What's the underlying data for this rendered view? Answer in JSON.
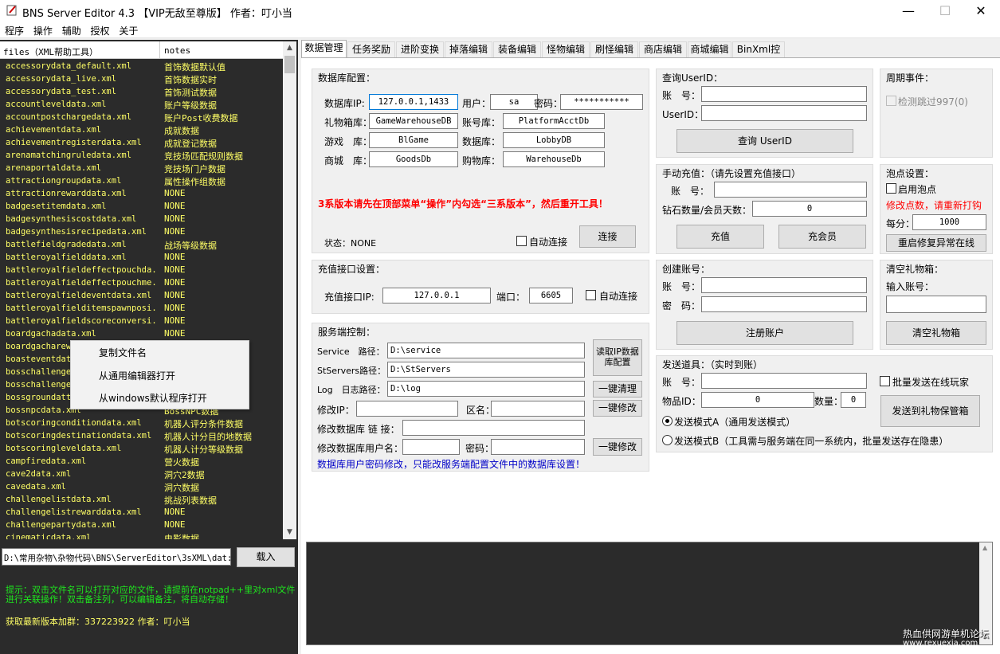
{
  "window": {
    "title": "BNS Server Editor 4.3 【VIP无敌至尊版】 作者：叮小当",
    "minimize": "—",
    "maximize": "☐",
    "close": "✕"
  },
  "menu": [
    "程序",
    "操作",
    "辅助",
    "授权",
    "关于"
  ],
  "file_list": {
    "col_files": "files（XML帮助工具）",
    "col_notes": "notes",
    "rows": [
      {
        "file": "accessorydata_default.xml",
        "note": "首饰数据默认值"
      },
      {
        "file": "accessorydata_live.xml",
        "note": "首饰数据实时"
      },
      {
        "file": "accessorydata_test.xml",
        "note": "首饰测试数据"
      },
      {
        "file": "accountleveldata.xml",
        "note": "账户等级数据"
      },
      {
        "file": "accountpostchargedata.xml",
        "note": "账户Post收费数据"
      },
      {
        "file": "achievementdata.xml",
        "note": "成就数据"
      },
      {
        "file": "achievementregisterdata.xml",
        "note": "成就登记数据"
      },
      {
        "file": "arenamatchingruledata.xml",
        "note": "竞技场匹配规则数据"
      },
      {
        "file": "arenaportaldata.xml",
        "note": "竞技场门户数据"
      },
      {
        "file": "attractiongroupdata.xml",
        "note": "属性操作组数据"
      },
      {
        "file": "attractionrewarddata.xml",
        "note": "NONE"
      },
      {
        "file": "badgesetitemdata.xml",
        "note": "NONE"
      },
      {
        "file": "badgesynthesiscostdata.xml",
        "note": "NONE"
      },
      {
        "file": "badgesynthesisrecipedata.xml",
        "note": "NONE"
      },
      {
        "file": "battlefieldgradedata.xml",
        "note": "战场等级数据"
      },
      {
        "file": "battleroyalfielddata.xml",
        "note": "NONE"
      },
      {
        "file": "battleroyalfieldeffectpouchda...",
        "note": "NONE"
      },
      {
        "file": "battleroyalfieldeffectpouchme...",
        "note": "NONE"
      },
      {
        "file": "battleroyalfieldeventdata.xml",
        "note": "NONE"
      },
      {
        "file": "battleroyalfielditemspawnposi...",
        "note": "NONE"
      },
      {
        "file": "battleroyalfieldscoreconversi...",
        "note": "NONE"
      },
      {
        "file": "boardgachadata.xml",
        "note": "NONE"
      },
      {
        "file": "boardgacharewa",
        "note": ""
      },
      {
        "file": "boasteventdate",
        "note": ""
      },
      {
        "file": "bosschallenged",
        "note": ""
      },
      {
        "file": "bosschallenger",
        "note": ""
      },
      {
        "file": "bossgroundatte",
        "note": "模..."
      },
      {
        "file": "bossnpcdata.xml",
        "note": "BossNPC数据"
      },
      {
        "file": "botscoringconditiondata.xml",
        "note": "机器人评分条件数据"
      },
      {
        "file": "botscoringdestinationdata.xml",
        "note": "机器人计分目的地数据"
      },
      {
        "file": "botscoringleveldata.xml",
        "note": "机器人计分等级数据"
      },
      {
        "file": "campfiredata.xml",
        "note": "营火数据"
      },
      {
        "file": "cave2data.xml",
        "note": "洞穴2数据"
      },
      {
        "file": "cavedata.xml",
        "note": "洞穴数据"
      },
      {
        "file": "challengelistdata.xml",
        "note": "挑战列表数据"
      },
      {
        "file": "challengelistrewarddata.xml",
        "note": "NONE"
      },
      {
        "file": "challengepartydata.xml",
        "note": "NONE"
      },
      {
        "file": "cinematicdata.xml",
        "note": "电影数据"
      }
    ]
  },
  "context_menu": [
    "复制文件名",
    "从通用编辑器打开",
    "从windows默认程序打开"
  ],
  "path_value": "D:\\常用杂物\\杂物代码\\BNS\\ServerEditor\\3sXML\\dat:",
  "load_button": "载入",
  "tip_text": "提示：双击文件名可以打开对应的文件，请提前在notpad++里对xml文件进行关联操作！双击备注列，可以编辑备注，将自动存储！",
  "group_text": "获取最新版本加群：337223922 作者：叮小当",
  "tabs": [
    "数据管理",
    "任务奖励",
    "进阶变换",
    "掉落编辑",
    "装备编辑",
    "怪物编辑",
    "刷怪编辑",
    "商店编辑",
    "商城编辑",
    "BinXml控制"
  ],
  "db_config": {
    "title": "数据库配置：",
    "ip_label": "数据库IP:",
    "ip": "127.0.0.1,1433",
    "user_label": "用户：",
    "user": "sa",
    "pwd_label": "密码：",
    "pwd": "***********",
    "gift_label": "礼物箱库：",
    "gift": "GameWarehouseDB",
    "acct_label": "账号库：",
    "acct": "PlatformAcctDb",
    "game_label": "游戏　库：",
    "game": "BlGame",
    "data_label": "数据库：",
    "data": "LobbyDB",
    "mall_label": "商城　库：",
    "mall": "GoodsDb",
    "cart_label": "购物库：",
    "cart": "WarehouseDb",
    "warning": "3系版本请先在顶部菜单“操作”内勾选“三系版本”，然后重开工具！",
    "status_label": "状态：NONE",
    "auto_connect": "自动连接",
    "connect_btn": "连接"
  },
  "charge_config": {
    "title": "充值接口设置：",
    "ip_label": "充值接口IP:",
    "ip": "127.0.0.1",
    "port_label": "端口：",
    "port": "6605",
    "auto_connect": "自动连接"
  },
  "server_ctrl": {
    "title": "服务端控制：",
    "service_label": "Service　路径：",
    "service": "D:\\service",
    "st_label": "StServers路径：",
    "st": "D:\\StServers",
    "log_label": "Log　日志路径：",
    "log": "D:\\log",
    "read_btn": "读取IP数据库配置",
    "clear_btn": "一键清理",
    "modify_ip_label": "修改IP：",
    "zone_label": "区名：",
    "modify_btn1": "一键修改",
    "db_link_label": "修改数据库 链 接：",
    "db_user_label": "修改数据库用户名：",
    "db_pwd_label": "密码：",
    "modify_btn2": "一键修改",
    "note": "数据库用户密码修改，只能改服务端配置文件中的数据库设置！"
  },
  "query_userid": {
    "title": "查询UserID：",
    "acct_label": "账　号：",
    "uid_label": "UserID：",
    "btn": "查询 UserID"
  },
  "periodic": {
    "title": "周期事件：",
    "check": "检测跳过997(0)"
  },
  "manual_charge": {
    "title": "手动充值：（请先设置充值接口）",
    "acct_label": "账　号：",
    "days_label": "钻石数量/会员天数：",
    "days": "0",
    "charge_btn": "充值",
    "vip_btn": "充会员"
  },
  "bubble": {
    "title": "泡点设置：",
    "enable": "启用泡点",
    "warn": "修改点数，请重新打钩",
    "per_min_label": "每分：",
    "per_min": "1000",
    "restart_btn": "重启修复异常在线"
  },
  "create_account": {
    "title": "创建账号：",
    "acct_label": "账　号：",
    "pwd_label": "密　码：",
    "btn": "注册账户"
  },
  "clear_gift": {
    "title": "清空礼物箱：",
    "input_label": "输入账号：",
    "btn": "清空礼物箱"
  },
  "send_item": {
    "title": "发送道具：（实时到账）",
    "acct_label": "账　号：",
    "batch": "批量发送在线玩家",
    "itemid_label": "物品ID：",
    "itemid": "0",
    "qty_label": "数量：",
    "qty": "0",
    "mode_a": "发送模式A（通用发送模式）",
    "mode_b": "发送模式B（工具需与服务端在同一系统内，批量发送存在隐患）",
    "send_btn": "发送到礼物保管箱"
  },
  "watermark": {
    "line1": "热血供网游单机论坛",
    "line2": "www.rexuexia.com"
  }
}
